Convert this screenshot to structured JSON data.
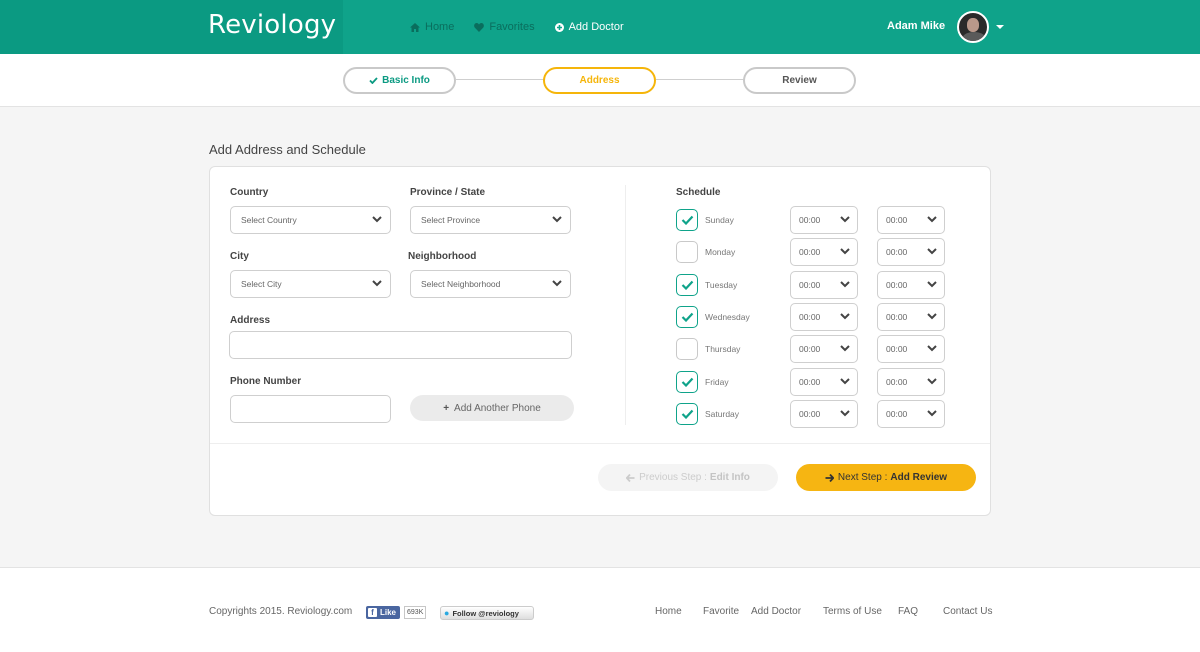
{
  "header": {
    "logo": "Reviology",
    "nav": [
      {
        "label": "Home",
        "icon": "home-icon"
      },
      {
        "label": "Favorites",
        "icon": "heart-icon"
      },
      {
        "label": "Add Doctor",
        "icon": "plus-circle-icon"
      }
    ],
    "user_name": "Adam Mike"
  },
  "steps": [
    {
      "label": "Basic Info",
      "state": "done"
    },
    {
      "label": "Address",
      "state": "current"
    },
    {
      "label": "Review",
      "state": "pending"
    }
  ],
  "page_title": "Add Address and Schedule",
  "form": {
    "country_label": "Country",
    "country_value": "Select Country",
    "province_label": "Province / State",
    "province_value": "Select Province",
    "city_label": "City",
    "city_value": "Select City",
    "neighborhood_label": "Neighborhood",
    "neighborhood_value": "Select Neighborhood",
    "address_label": "Address",
    "address_value": "",
    "phone_label": "Phone Number",
    "phone_value": "",
    "add_phone_label": "Add Another Phone"
  },
  "schedule": {
    "label": "Schedule",
    "days": [
      {
        "name": "Sunday",
        "checked": true,
        "from": "00:00",
        "to": "00:00"
      },
      {
        "name": "Monday",
        "checked": false,
        "from": "00:00",
        "to": "00:00"
      },
      {
        "name": "Tuesday",
        "checked": true,
        "from": "00:00",
        "to": "00:00"
      },
      {
        "name": "Wednesday",
        "checked": true,
        "from": "00:00",
        "to": "00:00"
      },
      {
        "name": "Thursday",
        "checked": false,
        "from": "00:00",
        "to": "00:00"
      },
      {
        "name": "Friday",
        "checked": true,
        "from": "00:00",
        "to": "00:00"
      },
      {
        "name": "Saturday",
        "checked": true,
        "from": "00:00",
        "to": "00:00"
      }
    ]
  },
  "actions": {
    "prev_prefix": "Previous Step :",
    "prev_target": "Edit Info",
    "next_prefix": "Next Step :",
    "next_target": "Add Review"
  },
  "footer": {
    "copyright": "Copyrights 2015. Reviology.com",
    "fb_like": "Like",
    "fb_count": "693K",
    "twitter": "Follow @reviology",
    "links": [
      "Home",
      "Favorite",
      "Add Doctor",
      "Terms of Use",
      "FAQ",
      "Contact Us"
    ]
  },
  "colors": {
    "brand_green": "#0fa38a",
    "accent_yellow": "#f6b512"
  }
}
